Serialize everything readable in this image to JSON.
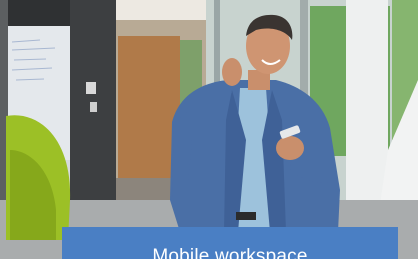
{
  "caption": {
    "text": "Mobile workspace",
    "bg_color": "#4a7fc4",
    "text_color": "#ffffff"
  },
  "scene": {
    "subject": "man-talking-on-phone",
    "colors": {
      "blazer": "#4a6fa6",
      "shirt": "#9dc2dc",
      "chair": "#9cc026",
      "office_wood": "#b07a49"
    }
  }
}
